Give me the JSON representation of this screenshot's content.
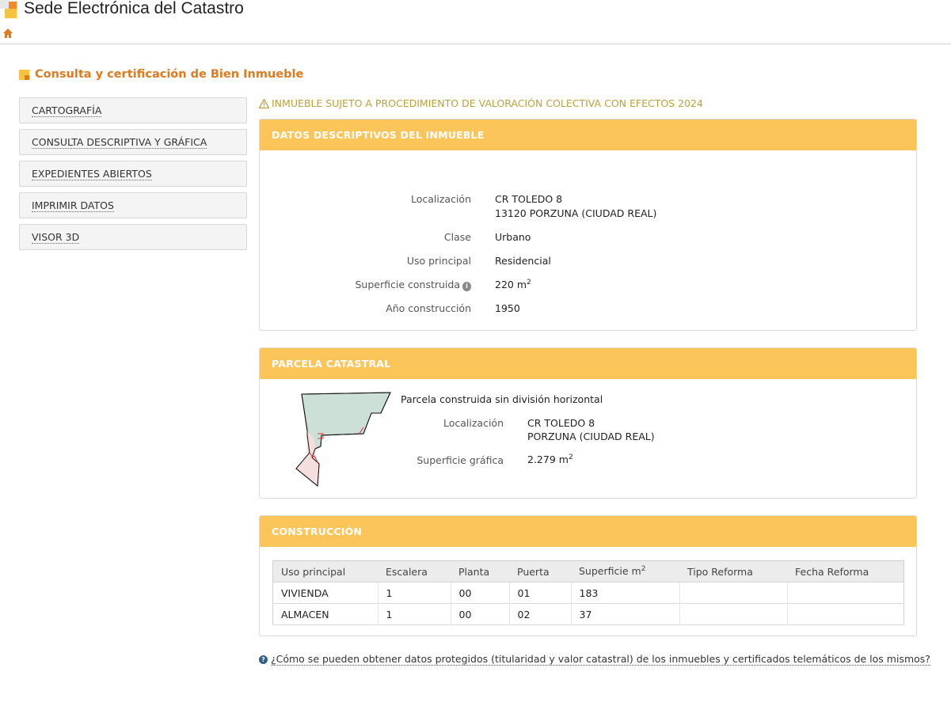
{
  "header": {
    "app_title": "Sede Electrónica del Catastro",
    "page_title": "Consulta y certificación de Bien Inmueble"
  },
  "colors": {
    "accent": "#e07a1f",
    "panel_header": "#fcc55a",
    "warning": "#b9a33a"
  },
  "sidebar": {
    "items": [
      {
        "label": "CARTOGRAFÍA"
      },
      {
        "label": "CONSULTA DESCRIPTIVA Y GRÁFICA"
      },
      {
        "label": "EXPEDIENTES ABIERTOS"
      },
      {
        "label": "IMPRIMIR DATOS"
      },
      {
        "label": "VISOR 3D"
      }
    ]
  },
  "warning": "INMUEBLE SUJETO A PROCEDIMIENTO DE VALORACIÓN COLECTIVA CON EFECTOS 2024",
  "datos": {
    "title": "DATOS DESCRIPTIVOS DEL INMUEBLE",
    "localizacion_label": "Localización",
    "localizacion_line1": "CR TOLEDO 8",
    "localizacion_line2": "13120 PORZUNA (CIUDAD REAL)",
    "clase_label": "Clase",
    "clase": "Urbano",
    "uso_label": "Uso principal",
    "uso": "Residencial",
    "superficie_label": "Superficie construida",
    "superficie": "220 m",
    "superficie_sup": "2",
    "anio_label": "Año construcción",
    "anio": "1950"
  },
  "parcela": {
    "title": "PARCELA CATASTRAL",
    "tipo": "Parcela construida sin división horizontal",
    "localizacion_label": "Localización",
    "localizacion_line1": "CR TOLEDO 8",
    "localizacion_line2": "PORZUNA (CIUDAD REAL)",
    "superficie_label": "Superficie gráfica",
    "superficie": "2.279 m",
    "superficie_sup": "2"
  },
  "construccion": {
    "title": "CONSTRUCCIÓN",
    "headers": [
      "Uso principal",
      "Escalera",
      "Planta",
      "Puerta",
      "Superficie m",
      "Tipo Reforma",
      "Fecha Reforma"
    ],
    "superficie_sup": "2",
    "rows": [
      [
        "VIVIENDA",
        "1",
        "00",
        "01",
        "183",
        "",
        ""
      ],
      [
        "ALMACEN",
        "1",
        "00",
        "02",
        "37",
        "",
        ""
      ]
    ]
  },
  "help_link": "¿Cómo se pueden obtener datos protegidos (titularidad y valor catastral) de los inmuebles y certificados telemáticos de los mismos?",
  "icons": {
    "home": "home-icon",
    "warning": "warning-icon",
    "info": "info-icon",
    "help": "question-icon"
  }
}
